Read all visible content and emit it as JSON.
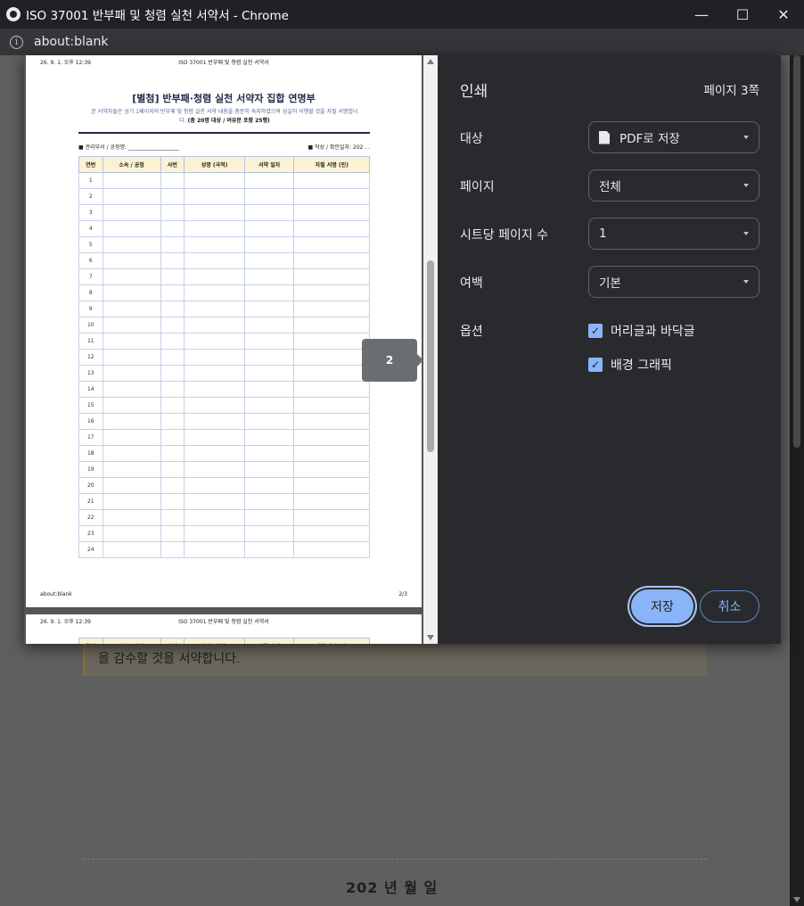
{
  "window": {
    "title": "ISO 37001 반부패 및 청렴 실천 서약서 - Chrome",
    "minimize": "—",
    "maximize": "☐",
    "close": "✕",
    "url": "about:blank"
  },
  "background_page": {
    "highlight_text": "을 감수할 것을 서약합니다.",
    "date_line": "202 년    월    일"
  },
  "preview": {
    "header_date": "26. 9. 1. 오후 12:39",
    "header_title": "ISO 37001 반부패 및 청렴 실천 서약서",
    "sheet_title": "[별첨] 반부패·청렴 실천 서약자 집합 연명부",
    "sheet_desc": "본 서약자들은 상기 1페이지의 반부패 및 청렴 실천 서약 내용을 충분히 숙지하였으며 성실히 이행할 것을 자필 서명합니",
    "sheet_desc_end": "다.",
    "sheet_desc_bold": "(총 20명 대상 / 여유분 포함 25행)",
    "meta_left": "■ 관리부서 / 공정명: ___________________",
    "meta_right": "■ 작성 / 확인일자: 202  .  .",
    "columns": [
      "연번",
      "소속 / 공정",
      "사번",
      "성명 (국적)",
      "서약 일자",
      "자필 서명 (인)"
    ],
    "rows": [
      "1",
      "2",
      "3",
      "4",
      "5",
      "6",
      "7",
      "8",
      "9",
      "10",
      "11",
      "12",
      "13",
      "14",
      "15",
      "16",
      "17",
      "18",
      "19",
      "20",
      "21",
      "22",
      "23",
      "24"
    ],
    "footer_left": "about:blank",
    "footer_right": "2/3",
    "page_tag": "2"
  },
  "print": {
    "title": "인쇄",
    "page_count": "페이지 3쪽",
    "destination_label": "대상",
    "destination_value": "PDF로 저장",
    "pages_label": "페이지",
    "pages_value": "전체",
    "pages_per_sheet_label": "시트당 페이지 수",
    "pages_per_sheet_value": "1",
    "margins_label": "여백",
    "margins_value": "기본",
    "options_label": "옵션",
    "option_headers": "머리글과 바닥글",
    "option_headers_checked": true,
    "option_background": "배경 그래픽",
    "option_background_checked": true,
    "save_button": "저장",
    "cancel_button": "취소"
  },
  "colors": {
    "accent": "#8ab4f8",
    "dialog_bg": "#292a2d",
    "table_header_bg": "#fbf2d3"
  }
}
